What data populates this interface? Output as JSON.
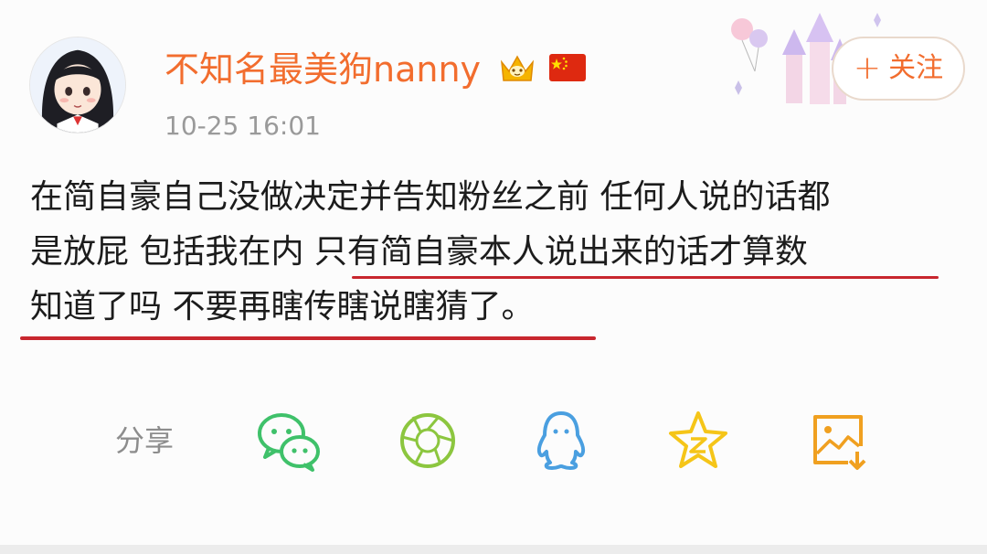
{
  "header": {
    "username": "不知名最美狗nanny",
    "timestamp": "10-25 16:01",
    "follow_label": "关注",
    "follow_plus": "+"
  },
  "post": {
    "lines": [
      "在简自豪自己没做决定并告知粉丝之前 任何人说的话都",
      "是放屁 包括我在内 只有简自豪本人说出来的话才算数",
      "知道了吗 不要再瞎传瞎说瞎猜了。"
    ],
    "highlight_color": "#c8262e"
  },
  "share": {
    "label": "分享",
    "targets": [
      {
        "icon": "wechat-icon",
        "color": "#3fc16a"
      },
      {
        "icon": "moments-icon",
        "color": "#8cc63f"
      },
      {
        "icon": "qq-icon",
        "color": "#4a9fe0"
      },
      {
        "icon": "qzone-icon",
        "color": "#f5c518"
      },
      {
        "icon": "save-image-icon",
        "color": "#f0a020"
      }
    ]
  },
  "colors": {
    "username": "#f26d2e",
    "text": "#1c1c1c",
    "muted": "#9a9a9a"
  }
}
